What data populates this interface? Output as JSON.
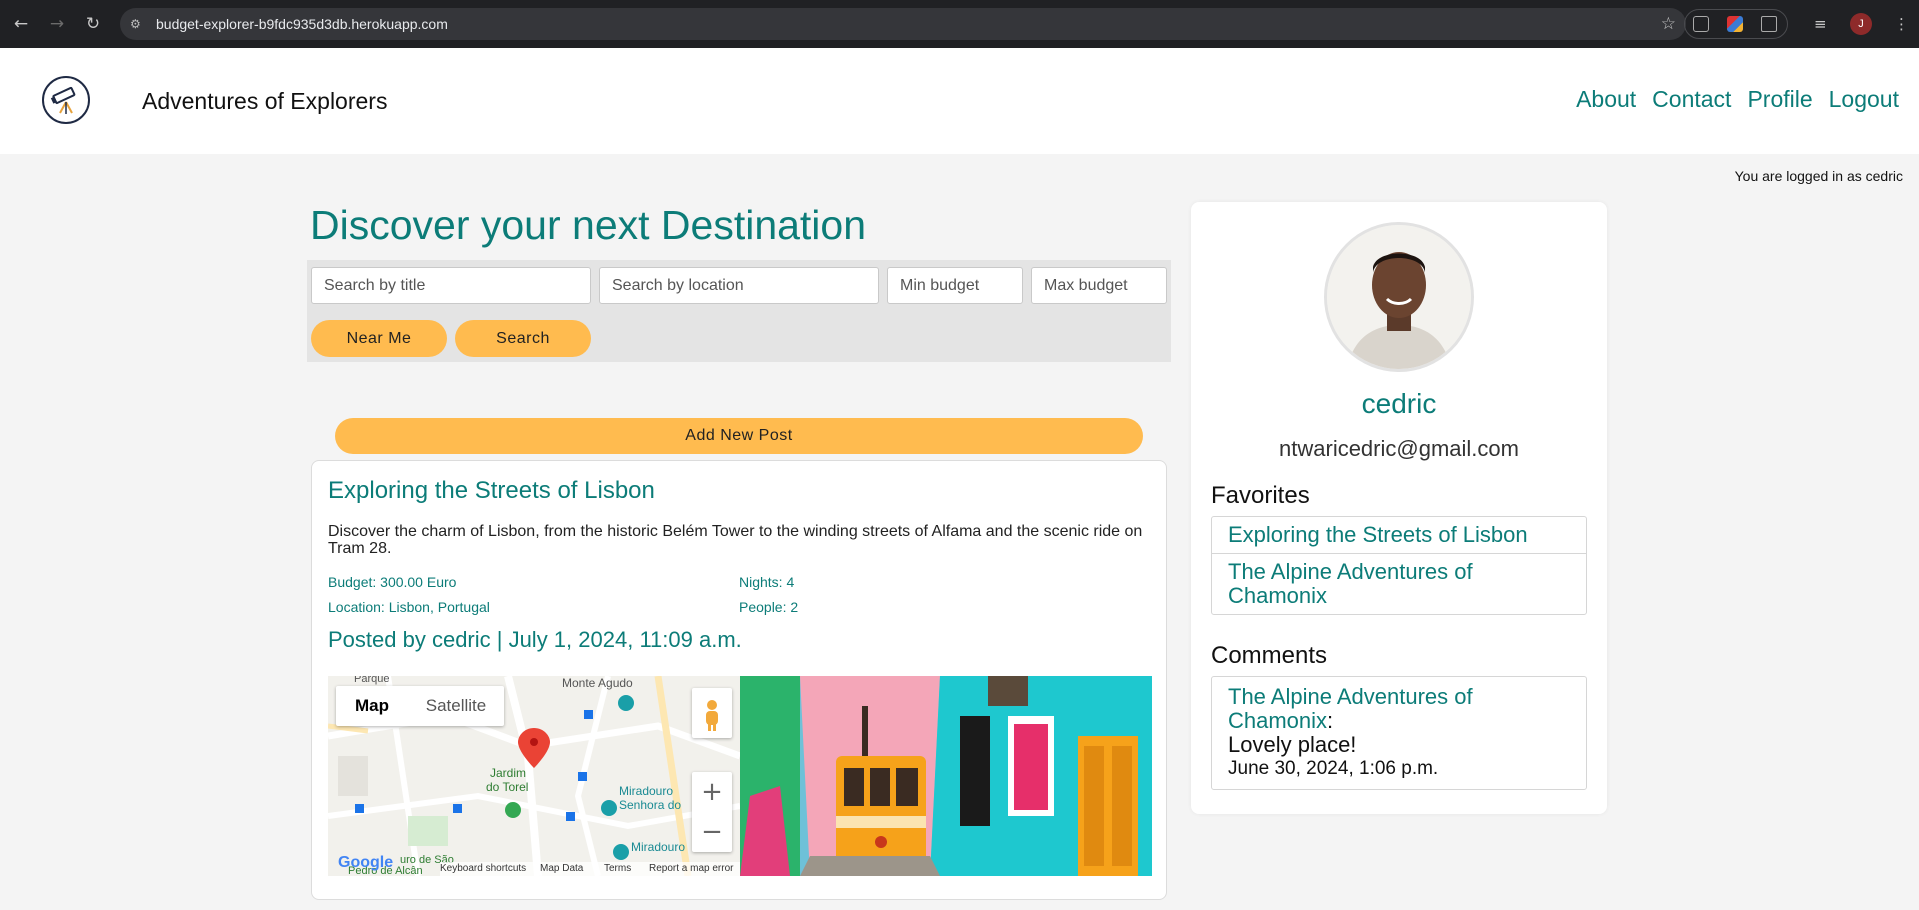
{
  "browser": {
    "url": "budget-explorer-b9fdc935d3db.herokuapp.com",
    "profile_initial": "J"
  },
  "site": {
    "brand": "Adventures of Explorers",
    "nav": [
      "About",
      "Contact",
      "Profile",
      "Logout"
    ],
    "logged_in_text": "You are logged in as cedric"
  },
  "main": {
    "title": "Discover your next Destination",
    "search": {
      "title_placeholder": "Search by title",
      "location_placeholder": "Search by location",
      "min_placeholder": "Min budget",
      "max_placeholder": "Max budget",
      "near_me_label": "Near Me",
      "search_label": "Search"
    },
    "add_post_label": "Add New Post",
    "post": {
      "title": "Exploring the Streets of Lisbon",
      "description": "Discover the charm of Lisbon, from the historic Belém Tower to the winding streets of Alfama and the scenic ride on Tram 28.",
      "budget": "Budget: 300.00 Euro",
      "nights": "Nights: 4",
      "location": "Location: Lisbon, Portugal",
      "people": "People: 2",
      "posted_by": "Posted by cedric | July 1, 2024, 11:09 a.m.",
      "map": {
        "map_tab": "Map",
        "satellite_tab": "Satellite",
        "labels": {
          "parque": "Parque",
          "monte_agudo": "Monte Agudo",
          "jardim_1": "Jardim",
          "jardim_2": "do Torel",
          "miradouro_1": "Miradouro",
          "miradouro_2": "Senhora do",
          "miradouro_3": "Miradouro",
          "bottom_1": "uro de São",
          "bottom_2": "Pedro de Alcân"
        },
        "footer": [
          "Keyboard shortcuts",
          "Map Data",
          "Terms",
          "Report a map error"
        ],
        "google": "Google"
      }
    }
  },
  "sidebar": {
    "username": "cedric",
    "email": "ntwaricedric@gmail.com",
    "favorites_heading": "Favorites",
    "favorites": [
      "Exploring the Streets of Lisbon",
      "The Alpine Adventures of Chamonix"
    ],
    "comments_heading": "Comments",
    "comments": [
      {
        "post": "The Alpine Adventures of Chamonix",
        "text": "Lovely place!",
        "date": "June 30, 2024, 1:06 p.m."
      }
    ]
  },
  "colors": {
    "accent": "#0c7c78",
    "button": "#ffbb4f"
  }
}
